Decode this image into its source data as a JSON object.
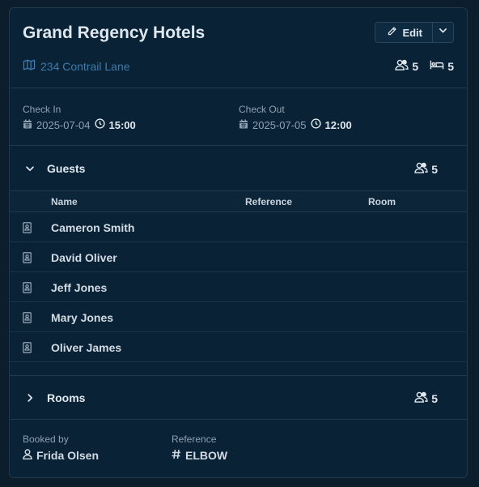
{
  "header": {
    "title": "Grand Regency Hotels",
    "edit_label": "Edit",
    "address": "234 Contrail Lane",
    "guest_count": "5",
    "bed_count": "5"
  },
  "dates": {
    "check_in_label": "Check In",
    "check_in_date": "2025-07-04",
    "check_in_time": "15:00",
    "check_out_label": "Check Out",
    "check_out_date": "2025-07-05",
    "check_out_time": "12:00"
  },
  "guests": {
    "title": "Guests",
    "count": "5",
    "columns": [
      "Name",
      "Reference",
      "Room"
    ],
    "rows": [
      {
        "name": "Cameron Smith"
      },
      {
        "name": "David Oliver"
      },
      {
        "name": "Jeff Jones"
      },
      {
        "name": "Mary Jones"
      },
      {
        "name": "Oliver James"
      }
    ]
  },
  "rooms": {
    "title": "Rooms",
    "count": "5"
  },
  "footer": {
    "booked_by_label": "Booked by",
    "booked_by_value": "Frida Olsen",
    "reference_label": "Reference",
    "reference_value": "ELBOW"
  },
  "colors": {
    "background": "#0c1d2b",
    "card": "#0a2236",
    "link": "#3f7aaa",
    "text": "#e1e8ee"
  }
}
